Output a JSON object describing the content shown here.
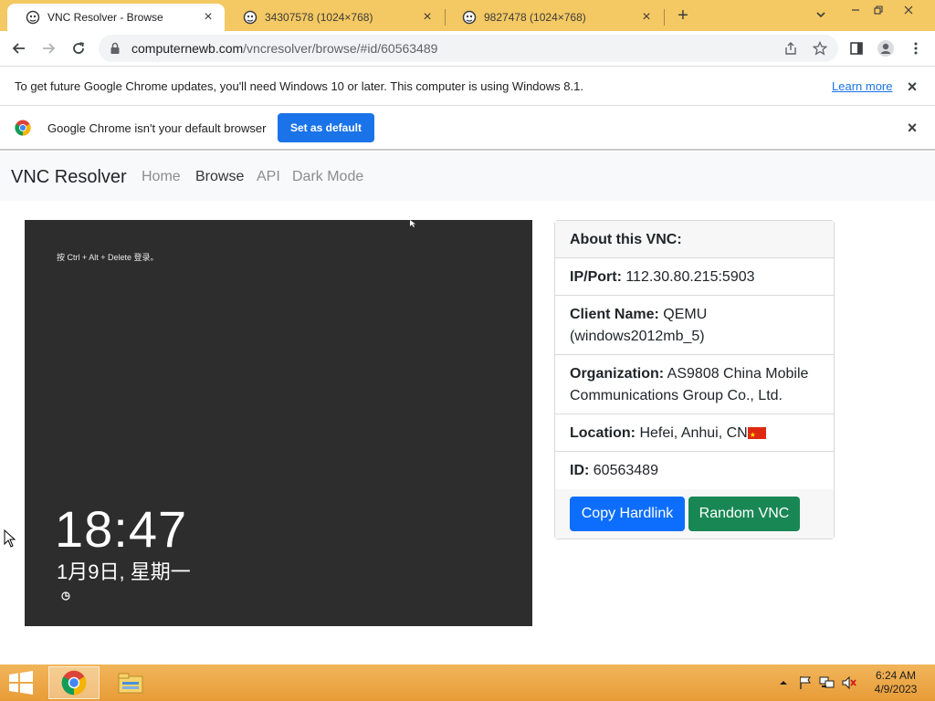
{
  "browser": {
    "tabs": [
      {
        "title": "VNC Resolver - Browse",
        "active": true
      },
      {
        "title": "34307578 (1024×768)",
        "active": false
      },
      {
        "title": "9827478 (1024×768)",
        "active": false
      }
    ],
    "url_host": "computernewb.com",
    "url_path": "/vncresolver/browse/#id/60563489",
    "infobar_update": {
      "message": "To get future Google Chrome updates, you'll need Windows 10 or later. This computer is using Windows 8.1.",
      "link": "Learn more"
    },
    "infobar_default": {
      "message": "Google Chrome isn't your default browser",
      "button": "Set as default"
    }
  },
  "site": {
    "brand": "VNC Resolver",
    "nav": [
      "Home",
      "Browse",
      "API",
      "Dark Mode"
    ],
    "active_nav": "Browse"
  },
  "vnc_screen": {
    "hint": "按 Ctrl + Alt + Delete 登录。",
    "time": "18:47",
    "date": "1月9日, 星期一"
  },
  "card": {
    "header": "About this VNC:",
    "ip_label": "IP/Port:",
    "ip_value": "112.30.80.215:5903",
    "client_label": "Client Name:",
    "client_value": "QEMU (windows2012mb_5)",
    "org_label": "Organization:",
    "org_value": "AS9808 China Mobile Communications Group Co., Ltd.",
    "loc_label": "Location:",
    "loc_value": "Hefei, Anhui, CN",
    "id_label": "ID:",
    "id_value": "60563489",
    "btn_copy": "Copy Hardlink",
    "btn_random": "Random VNC"
  },
  "taskbar": {
    "time": "6:24 AM",
    "date": "4/9/2023"
  },
  "colors": {
    "tabstrip": "#f4c862",
    "primary": "#0d6efd",
    "success": "#198754",
    "chrome_blue": "#1a73e8",
    "vnc_bg": "#2d2d2d"
  }
}
